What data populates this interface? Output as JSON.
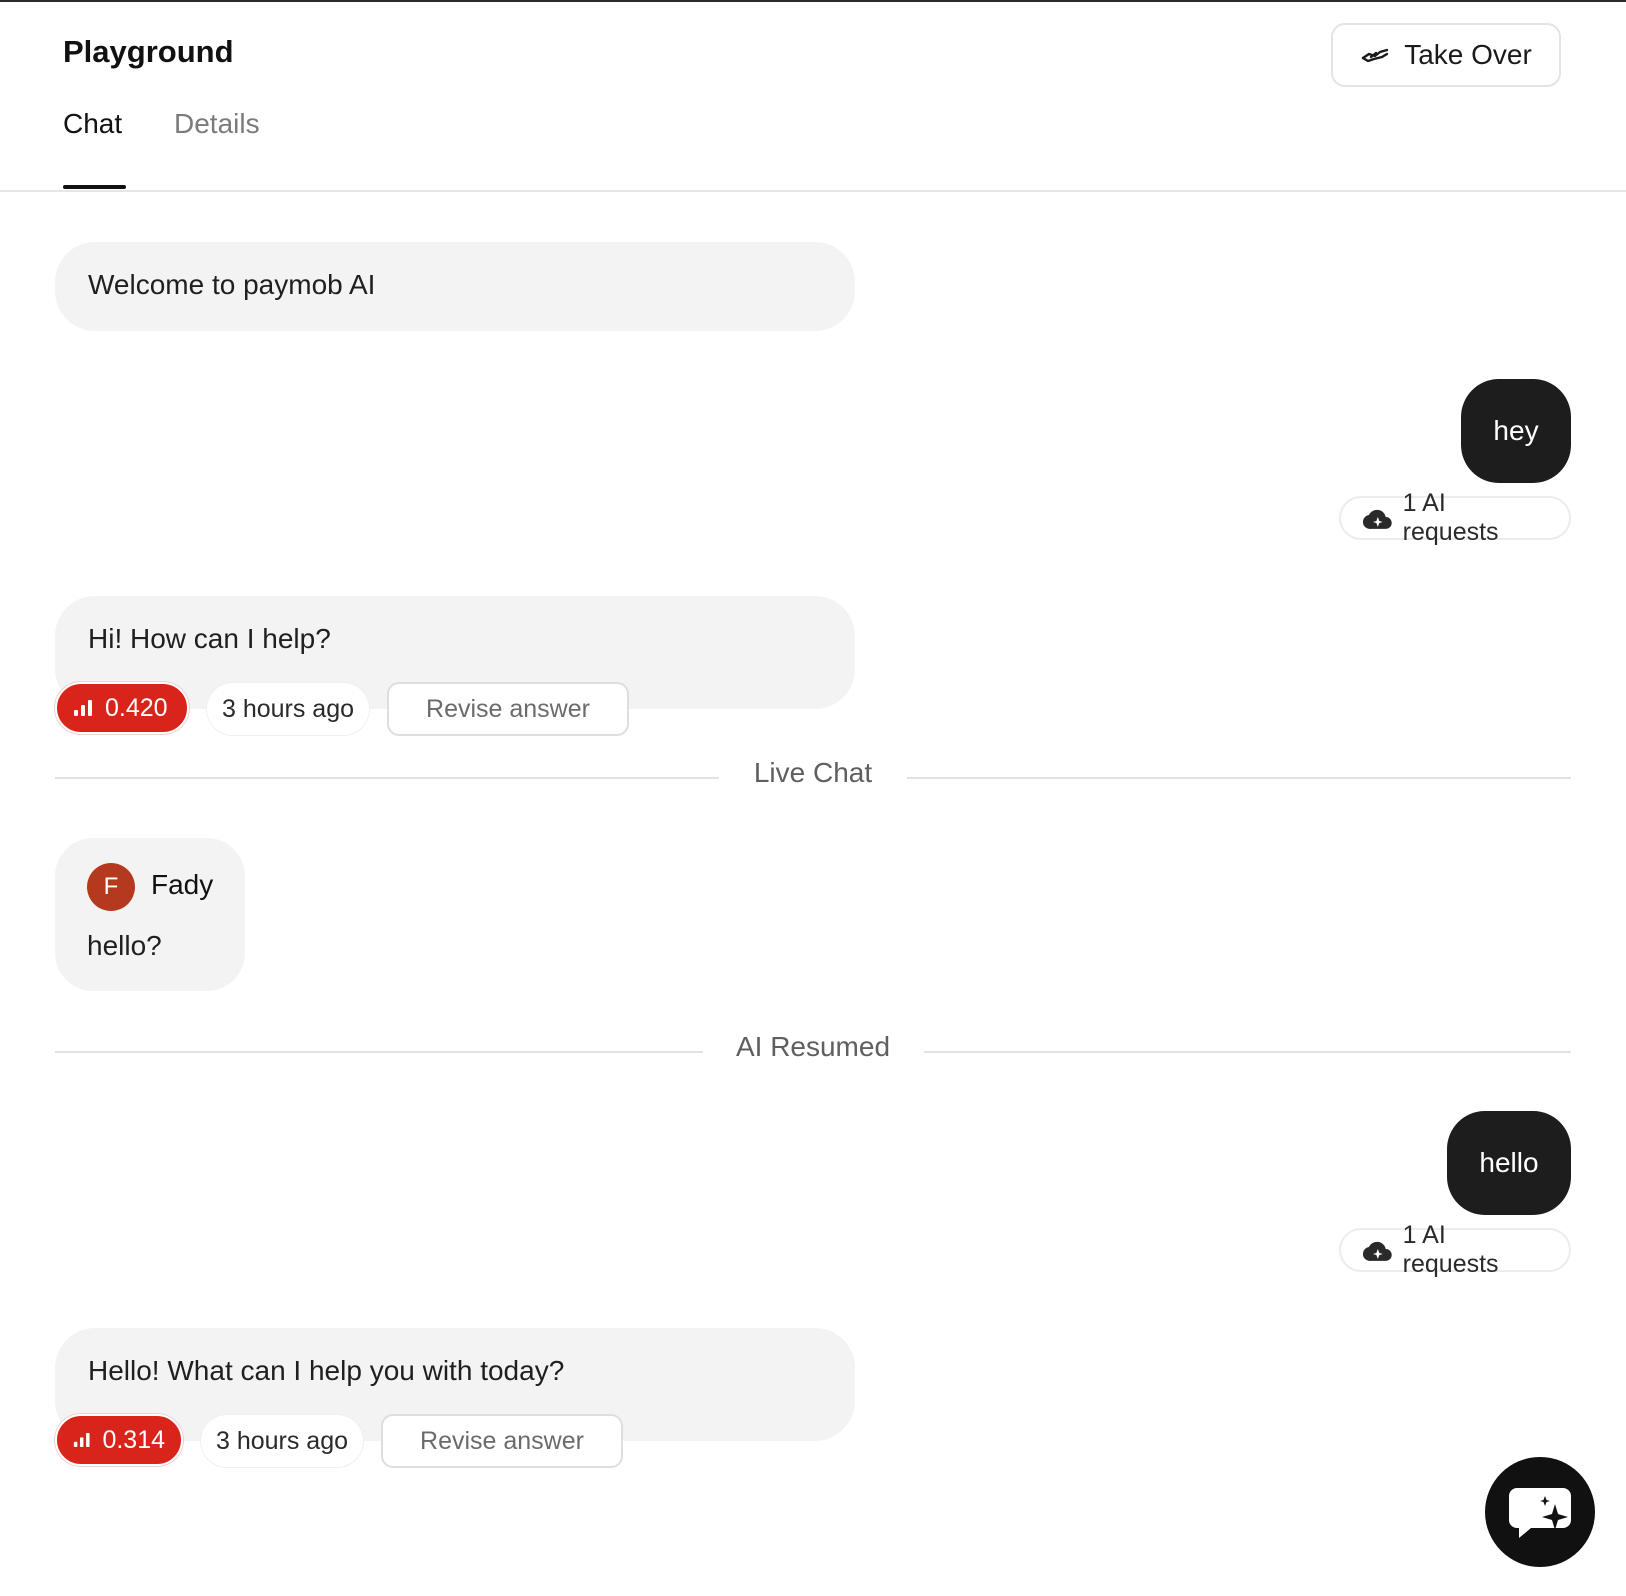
{
  "header": {
    "title": "Playground",
    "take_over_label": "Take Over"
  },
  "tabs": [
    {
      "label": "Chat",
      "active": true
    },
    {
      "label": "Details",
      "active": false
    }
  ],
  "messages": {
    "welcome": "Welcome to paymob AI",
    "user_1": "hey",
    "user_1_requests": "1 AI requests",
    "bot_1": "Hi! How can I help?",
    "bot_1_score": "0.420",
    "bot_1_time": "3 hours ago",
    "revise_label": "Revise answer",
    "live_chat_separator": "Live Chat",
    "agent": {
      "initial": "F",
      "name": "Fady",
      "message": "hello?"
    },
    "ai_resumed_separator": "AI Resumed",
    "user_2": "hello",
    "user_2_requests": "1 AI requests",
    "bot_2": "Hello! What can I help you with today?",
    "bot_2_score": "0.314",
    "bot_2_time": "3 hours ago"
  },
  "colors": {
    "score_red": "#d9241c",
    "user_bubble": "#1d1d1d",
    "bot_bubble": "#f3f3f3",
    "avatar": "#b5391f"
  },
  "icons": [
    "handshake-icon",
    "cloud-sparkle-icon",
    "signal-bars-icon",
    "chat-sparkle-icon"
  ]
}
